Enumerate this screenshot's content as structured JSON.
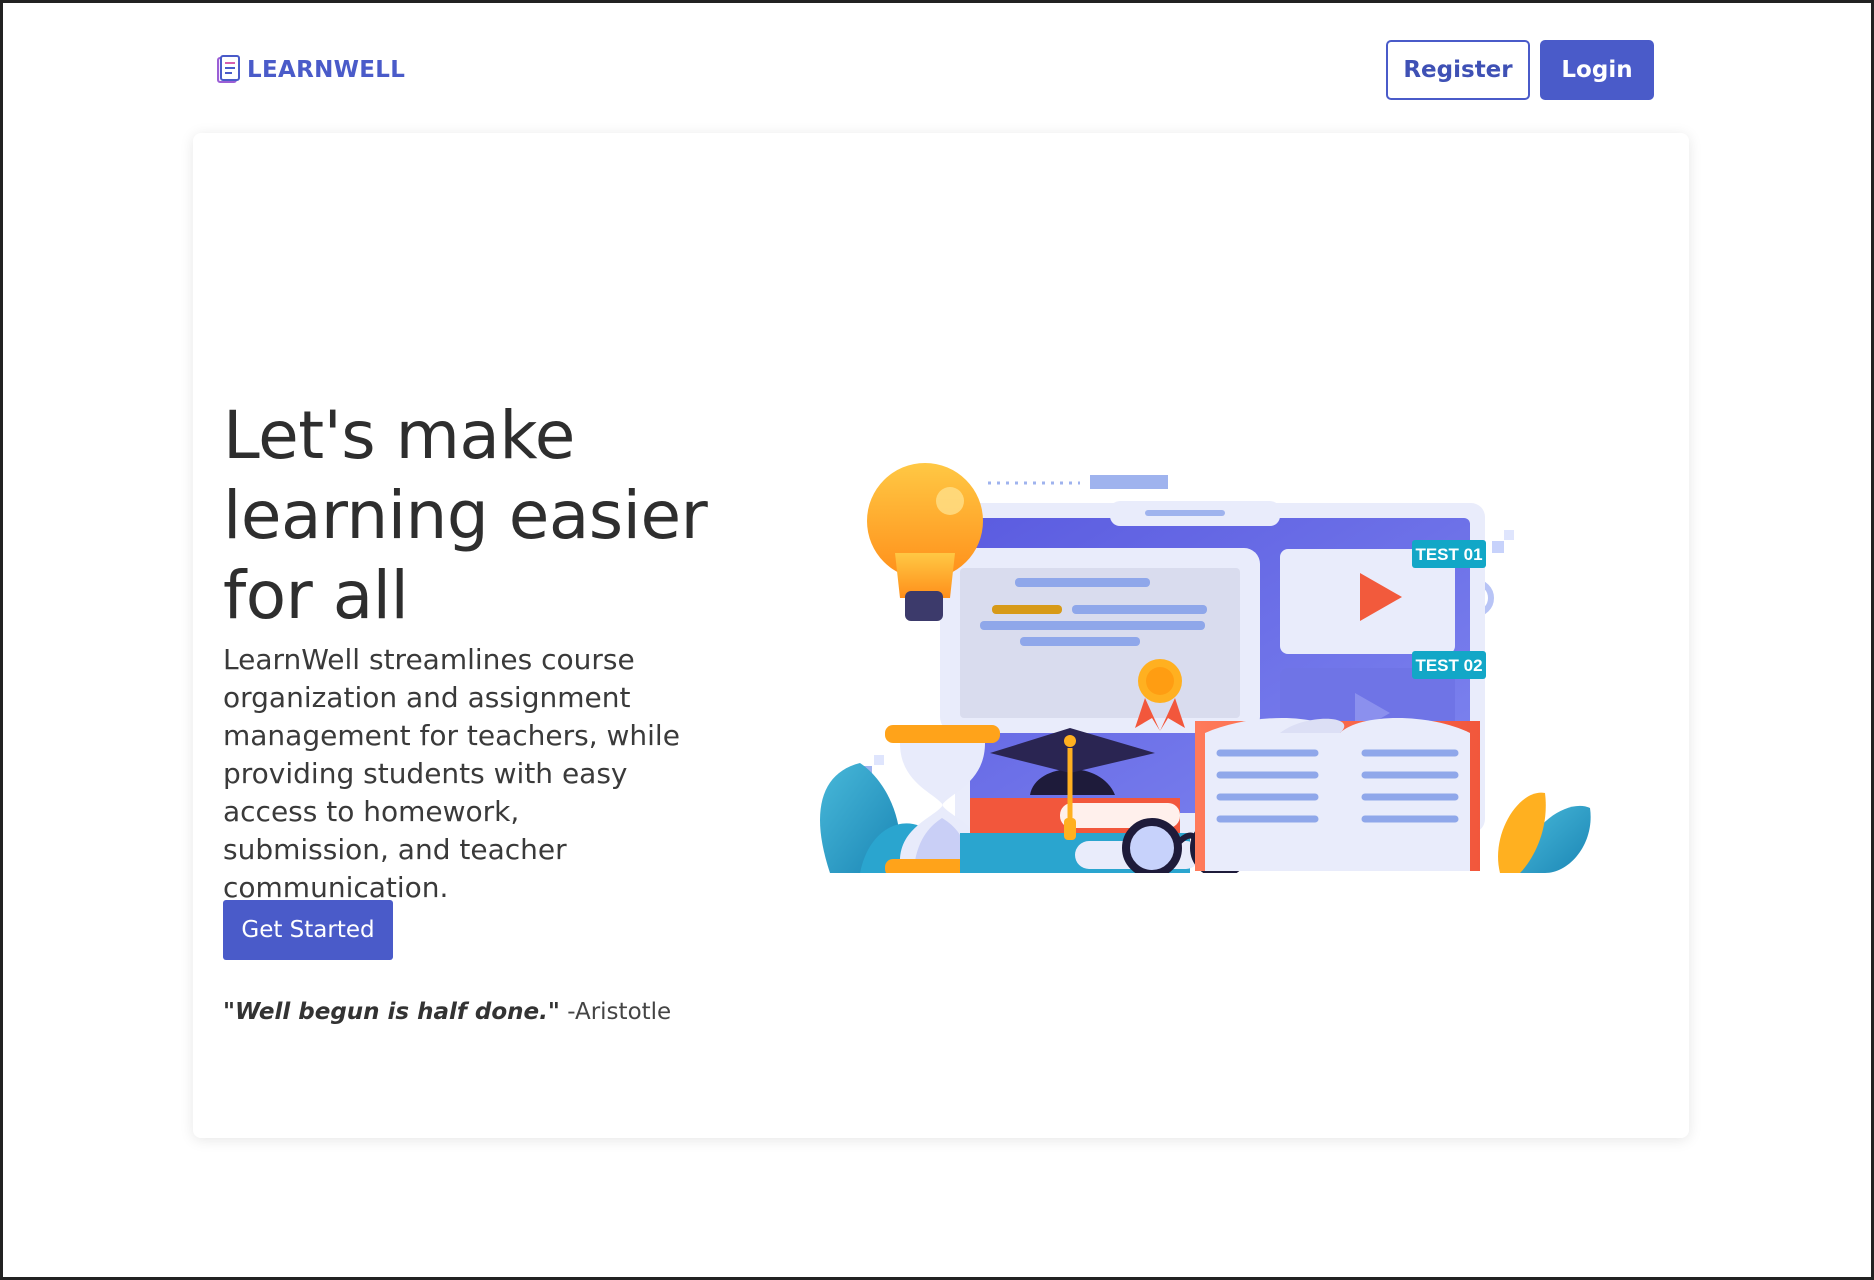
{
  "header": {
    "brand": "LEARNWELL",
    "register_label": "Register",
    "login_label": "Login"
  },
  "hero": {
    "title": "Let's make learning easier for all",
    "description": "LearnWell streamlines course organization and assignment management for teachers, while providing students with easy access to homework, submission, and teacher communication.",
    "cta_label": "Get Started",
    "quote_text": "\"Well begun is half done.\"",
    "quote_author": "-Aristotle"
  },
  "illustration": {
    "tag_1": "TEST 01",
    "tag_2": "TEST 02"
  },
  "colors": {
    "primary": "#4a5bc9",
    "text": "#333333",
    "tag": "#12a7c7"
  }
}
